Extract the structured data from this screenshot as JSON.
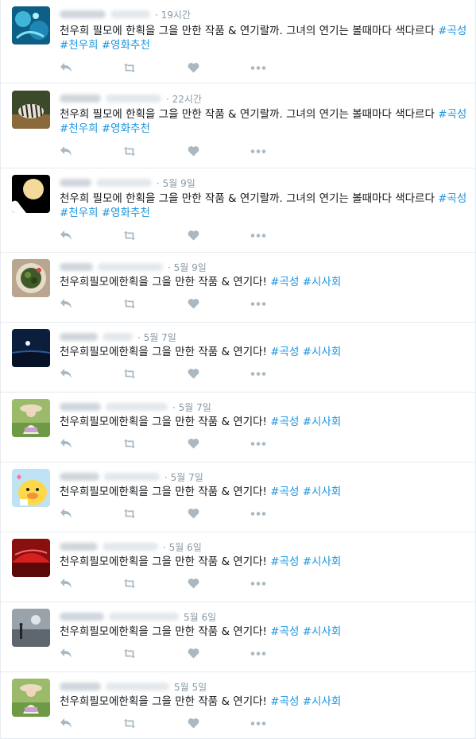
{
  "colors": {
    "hashtag": "#1b95e0",
    "icon": "#aab8c2",
    "time": "#8899a6",
    "divider": "#e6ecf0"
  },
  "tweets": [
    {
      "time": "· 19시간",
      "text": "천우희 필모에 한획을 그을 만한 작품 & 연기랄까. 그녀의 연기는 볼때마다 색다르다 ",
      "tags": [
        "#곡성",
        "#천우희",
        "#영화추천"
      ],
      "avatar": "underwater"
    },
    {
      "time": "· 22시간",
      "text": "천우희 필모에 한획을 그을 만한 작품 & 연기랄까. 그녀의 연기는 볼때마다 색다르다 ",
      "tags": [
        "#곡성",
        "#천우희",
        "#영화추천"
      ],
      "avatar": "zebra"
    },
    {
      "time": "· 5월 9일",
      "text": "천우희 필모에 한획을 그을 만한 작품 & 연기랄까. 그녀의 연기는 볼때마다 색다르다 ",
      "tags": [
        "#곡성",
        "#천우희",
        "#영화추천"
      ],
      "avatar": "moon"
    },
    {
      "time": "· 5월 9일",
      "text": "천우희필모에한획을 그을 만한 작품 & 연기다! ",
      "tags": [
        "#곡성",
        "#시사회"
      ],
      "avatar": "food"
    },
    {
      "time": "· 5월 7일",
      "text": "천우희필모에한획을 그을 만한 작품 & 연기다! ",
      "tags": [
        "#곡성",
        "#시사회"
      ],
      "avatar": "night"
    },
    {
      "time": "· 5월 7일",
      "text": "천우희필모에한획을 그을 만한 작품 & 연기다! ",
      "tags": [
        "#곡성",
        "#시사회"
      ],
      "avatar": "girl"
    },
    {
      "time": "· 5월 7일",
      "text": "천우희필모에한획을 그을 만한 작품 & 연기다! ",
      "tags": [
        "#곡성",
        "#시사회"
      ],
      "avatar": "duck"
    },
    {
      "time": "· 5월 6일",
      "text": "천우희필모에한획을 그을 만한 작품 & 연기다! ",
      "tags": [
        "#곡성",
        "#시사회"
      ],
      "avatar": "umbrella"
    },
    {
      "time": "5월 6일",
      "text": "천우희필모에한획을 그을 만한 작품 & 연기다! ",
      "tags": [
        "#곡성",
        "#시사회"
      ],
      "avatar": "beach"
    },
    {
      "time": "5월 5일",
      "text": "천우희필모에한획을 그을 만한 작품 & 연기다! ",
      "tags": [
        "#곡성",
        "#시사회"
      ],
      "avatar": "girl"
    }
  ]
}
